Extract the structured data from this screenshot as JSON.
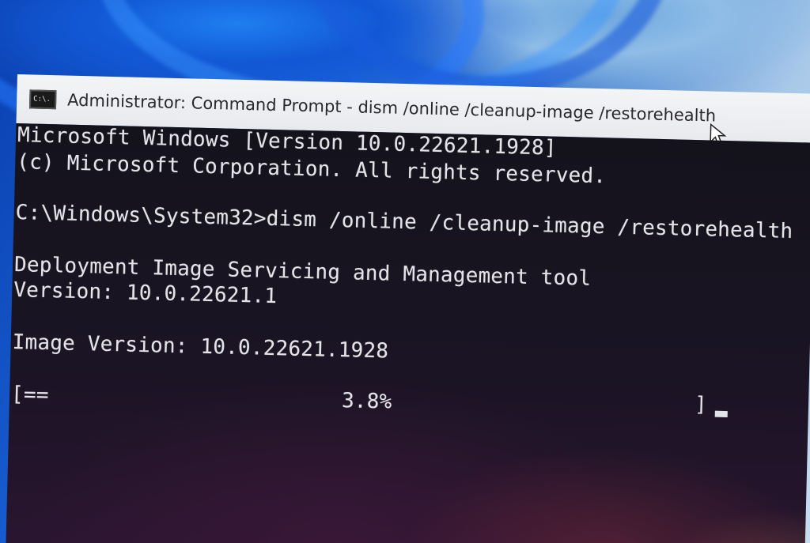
{
  "window": {
    "title": "Administrator: Command Prompt - dism  /online /cleanup-image /restorehealth",
    "icon_label": "C:\\.",
    "icon_name": "cmd-icon"
  },
  "console": {
    "lines": [
      "Microsoft Windows [Version 10.0.22621.1928]",
      "(c) Microsoft Corporation. All rights reserved.",
      "C:\\Windows\\System32>dism /online /cleanup-image /restorehealth",
      "Deployment Image Servicing and Management tool",
      "Version: 10.0.22621.1",
      "Image Version: 10.0.22621.1928"
    ],
    "progress": {
      "open": "[==",
      "percent_text": "3.8%",
      "close": "]",
      "fraction": 0.038
    }
  },
  "colors": {
    "console_text": "#e4e4e8",
    "titlebar_bg": "#f0f1f4"
  }
}
